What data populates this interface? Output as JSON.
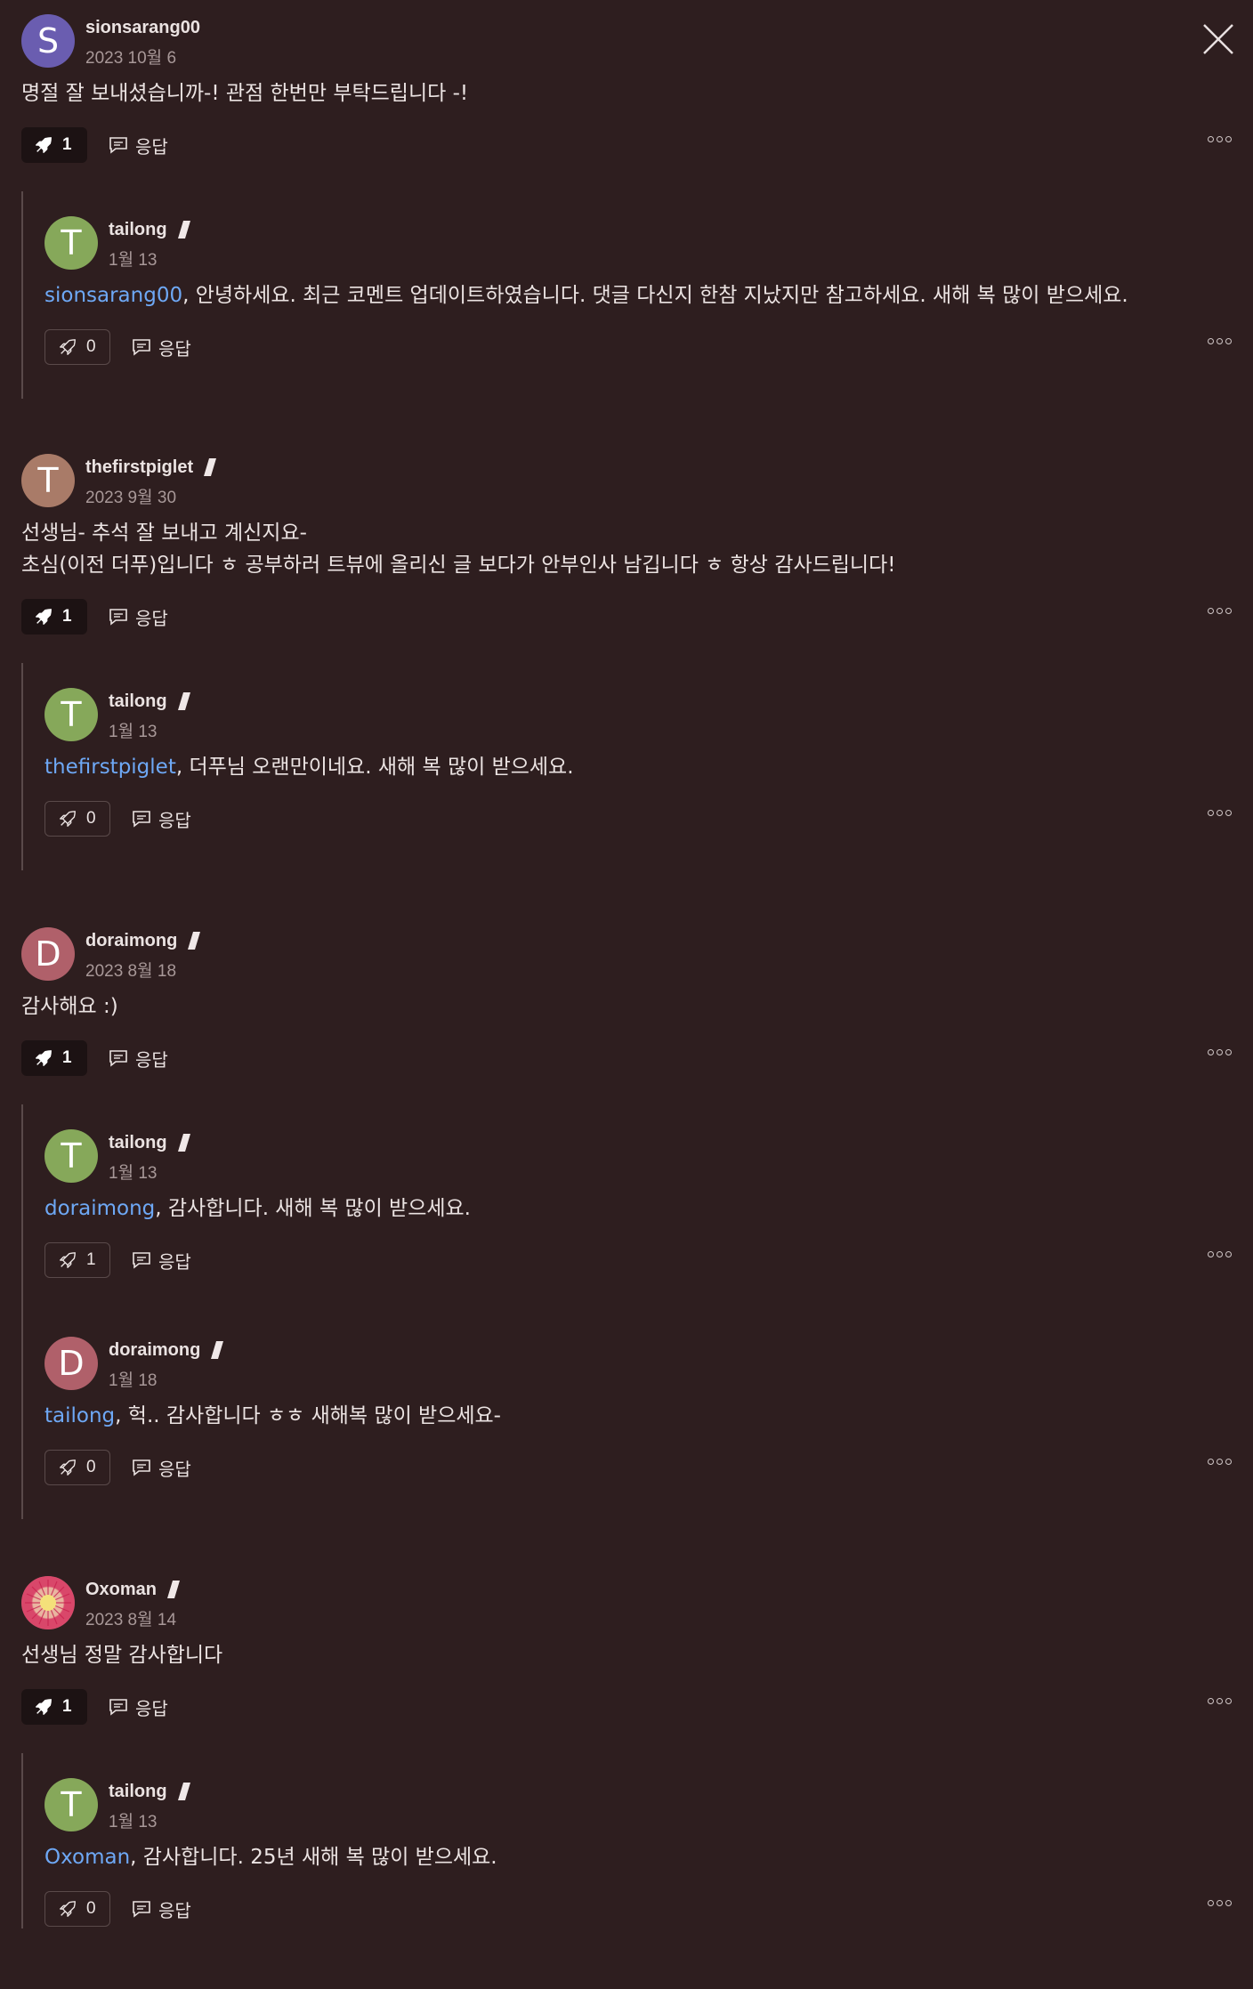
{
  "close_label": "close",
  "reply_label": "응답",
  "colors": {
    "background": "#2e1e1f",
    "mention": "#6ea8f5",
    "avatar_s": "#6a5db0",
    "avatar_t_green": "#86a85a",
    "avatar_t_brown": "#a97b68",
    "avatar_d": "#b0606a"
  },
  "threads": [
    {
      "comment": {
        "initial": "S",
        "username": "sionsarang00",
        "date": "2023 10월 6",
        "text": "명절 잘 보내셨습니까-! 관점 한번만 부탁드립니다 -!",
        "likes": "1"
      },
      "replies": [
        {
          "initial": "T",
          "username": "tailong",
          "date": "1월 13",
          "mention": "sionsarang00",
          "text": ", 안녕하세요. 최근 코멘트 업데이트하였습니다. 댓글 다신지 한참 지났지만 참고하세요. 새해 복 많이 받으세요.",
          "likes": "0"
        }
      ]
    },
    {
      "comment": {
        "initial": "T",
        "username": "thefirstpiglet",
        "date": "2023 9월 30",
        "text": "선생님- 추석 잘 보내고 계신지요-\n초심(이전 더푸)입니다 ㅎ 공부하러 트뷰에 올리신 글 보다가 안부인사 남깁니다 ㅎ 항상 감사드립니다!",
        "likes": "1"
      },
      "replies": [
        {
          "initial": "T",
          "username": "tailong",
          "date": "1월 13",
          "mention": "thefirstpiglet",
          "text": ", 더푸님 오랜만이네요. 새해 복 많이 받으세요.",
          "likes": "0"
        }
      ]
    },
    {
      "comment": {
        "initial": "D",
        "username": "doraimong",
        "date": "2023 8월 18",
        "text": "감사해요 :)",
        "likes": "1"
      },
      "replies": [
        {
          "initial": "T",
          "username": "tailong",
          "date": "1월 13",
          "mention": "doraimong",
          "text": ", 감사합니다. 새해 복 많이 받으세요.",
          "likes": "1"
        },
        {
          "initial": "D",
          "username": "doraimong",
          "date": "1월 18",
          "mention": "tailong",
          "text": ", 헉.. 감사합니다 ㅎㅎ 새해복 많이 받으세요-",
          "likes": "0"
        }
      ]
    },
    {
      "comment": {
        "initial": "",
        "username": "Oxoman",
        "date": "2023 8월 14",
        "text": "선생님 정말 감사합니다",
        "likes": "1"
      },
      "replies": [
        {
          "initial": "T",
          "username": "tailong",
          "date": "1월 13",
          "mention": "Oxoman",
          "text": ", 감사합니다. 25년 새해 복 많이 받으세요.",
          "likes": "0"
        }
      ]
    }
  ]
}
